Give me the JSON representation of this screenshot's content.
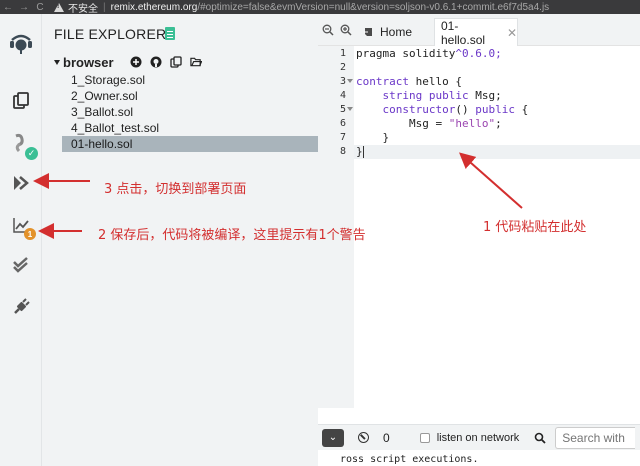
{
  "browser": {
    "back_arrow": "←",
    "forward_arrow": "→",
    "reload": "C",
    "security_label": "不安全",
    "separator": "|",
    "url_domain": "remix.ethereum.org",
    "url_rest": "/#optimize=false&evmVersion=null&version=soljson-v0.6.1+commit.e6f7d5a4.js"
  },
  "icon_bar": {
    "items": [
      "remix-logo-icon",
      "file-explorer-icon",
      "compiler-icon",
      "deploy-run-icon",
      "analysis-icon",
      "testing-icon",
      "plugin-manager-icon"
    ],
    "warning_badge": "1",
    "check_badge": "✓"
  },
  "explorer": {
    "title": "FILE EXPLORERS",
    "workspace": "browser",
    "files": [
      "1_Storage.sol",
      "2_Owner.sol",
      "3_Ballot.sol",
      "4_Ballot_test.sol",
      "01-hello.sol"
    ],
    "selected_file": "01-hello.sol"
  },
  "editor": {
    "zoom_out": "−",
    "zoom_in": "+",
    "home_tab": "Home",
    "file_tab": "01-hello.sol",
    "tab_close": "✕",
    "line_numbers": [
      "1",
      "2",
      "3",
      "4",
      "5",
      "6",
      "7",
      "8"
    ],
    "code": {
      "l1_a": "pragma solidity",
      "l1_b": "^0.6.0;",
      "l3_kw": "contract",
      "l3_rest": " hello {",
      "l4_kw": "string public",
      "l4_rest": " Msg;",
      "l5_kw": "constructor",
      "l5_mid": "() ",
      "l5_kw2": "public",
      "l5_rest": " {",
      "l6_a": "Msg = ",
      "l6_str": "\"hello\"",
      "l6_end": ";",
      "l7": "}",
      "l8": "}"
    }
  },
  "terminal": {
    "toggle_label": "⌄",
    "count": "0",
    "listen_label": "listen on network",
    "search_placeholder": "Search with",
    "output": "ross script executions."
  },
  "annotations": {
    "a1": "1 代码粘贴在此处",
    "a2": "2 保存后，代码将被编译，这里提示有1个警告",
    "a3": "3 点击，切换到部署页面",
    "color": "#d32f2f"
  }
}
